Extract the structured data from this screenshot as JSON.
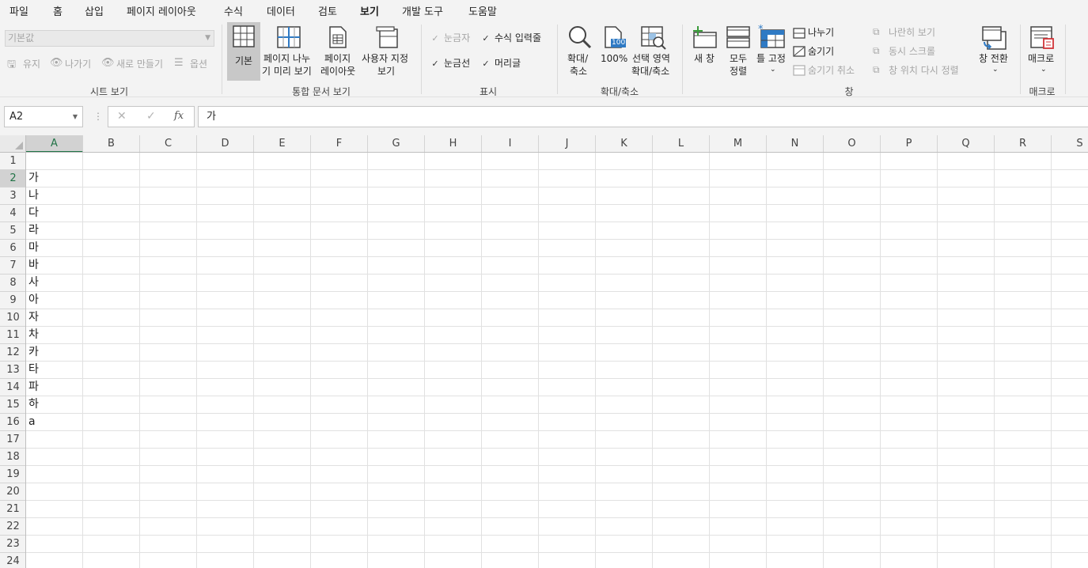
{
  "menu": {
    "tabs": [
      {
        "label": "파일",
        "active": false
      },
      {
        "label": "홈",
        "active": false
      },
      {
        "label": "삽입",
        "active": false
      },
      {
        "label": "페이지 레이아웃",
        "active": false
      },
      {
        "label": "수식",
        "active": false
      },
      {
        "label": "데이터",
        "active": false
      },
      {
        "label": "검토",
        "active": false
      },
      {
        "label": "보기",
        "active": true
      },
      {
        "label": "개발 도구",
        "active": false
      },
      {
        "label": "도움말",
        "active": false
      }
    ]
  },
  "ribbon": {
    "sheet_view": {
      "label": "시트 보기",
      "style_select_value": "기본값",
      "keep_label": "유지",
      "exit_label": "나가기",
      "new_label": "새로 만들기",
      "options_label": "옵션"
    },
    "workbook_views": {
      "label": "통합 문서 보기",
      "normal_label": "기본",
      "page_break_line1": "페이지 나누",
      "page_break_line2": "기 미리 보기",
      "page_layout_line1": "페이지",
      "page_layout_line2": "레이아웃",
      "custom_line1": "사용자 지정",
      "custom_line2": "보기"
    },
    "show": {
      "label": "표시",
      "ruler_label": "눈금자",
      "formula_bar_label": "수식 입력줄",
      "gridlines_label": "눈금선",
      "headings_label": "머리글",
      "check_mark": "✓"
    },
    "zoom": {
      "label": "확대/축소",
      "zoom_line1": "확대/",
      "zoom_line2": "축소",
      "hundred_label": "100%",
      "hundred_icon_text": "100",
      "selection_line1": "선택 영역",
      "selection_line2": "확대/축소"
    },
    "window": {
      "label": "창",
      "new_window_label": "새 창",
      "arrange_line1": "모두",
      "arrange_line2": "정렬",
      "freeze_label": "틀 고정",
      "split_label": "나누기",
      "hide_label": "숨기기",
      "unhide_label": "숨기기 취소",
      "side_by_side_label": "나란히 보기",
      "sync_scroll_label": "동시 스크롤",
      "reset_position_label": "창 위치 다시 정렬",
      "switch_label": "창 전환"
    },
    "macros": {
      "label": "매크로",
      "macros_button_label": "매크로"
    }
  },
  "formula_bar": {
    "name_box": "A2",
    "cancel_glyph": "✕",
    "enter_glyph": "✓",
    "fx_glyph": "fx",
    "content": "가"
  },
  "sheet": {
    "columns": [
      "A",
      "B",
      "C",
      "D",
      "E",
      "F",
      "G",
      "H",
      "I",
      "J",
      "K",
      "L",
      "M",
      "N",
      "O",
      "P",
      "Q",
      "R",
      "S"
    ],
    "rows": [
      "1",
      "2",
      "3",
      "4",
      "5",
      "6",
      "7",
      "8",
      "9",
      "10",
      "11",
      "12",
      "13",
      "14",
      "15",
      "16",
      "17",
      "18",
      "19",
      "20",
      "21",
      "22",
      "23",
      "24"
    ],
    "selected_column": "A",
    "selected_row": "2",
    "cells_A": [
      "",
      "가",
      "나",
      "다",
      "라",
      "마",
      "바",
      "사",
      "아",
      "자",
      "차",
      "카",
      "타",
      "파",
      "하",
      "a"
    ]
  },
  "colors": {
    "accent": "#217346",
    "ribbon_bg": "#f3f3f3",
    "gridline": "#e1e1e1"
  }
}
